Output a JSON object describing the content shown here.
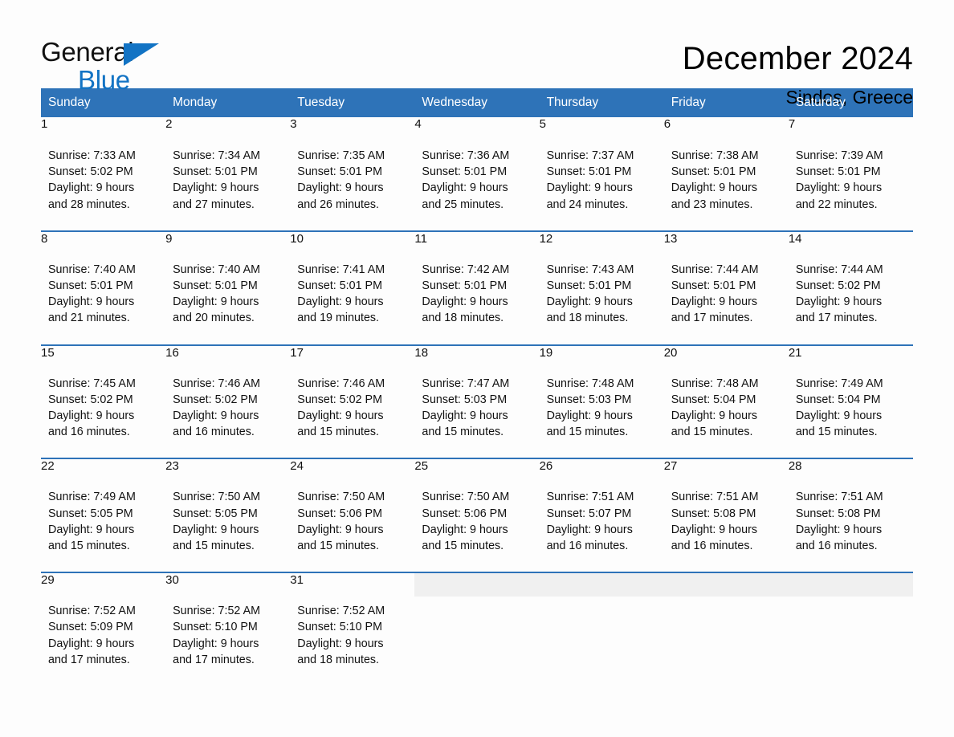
{
  "brand": {
    "name_part1": "General",
    "name_part2": "Blue",
    "triangle_color": "#1273c4"
  },
  "header": {
    "title": "December 2024",
    "subtitle": "Sindos, Greece"
  },
  "colors": {
    "header_blue": "#2e73b8",
    "daynum_band": "#f0f0f0",
    "page_background": "#fdfdfd",
    "text": "#111111"
  },
  "calendar": {
    "weekday_headers": [
      "Sunday",
      "Monday",
      "Tuesday",
      "Wednesday",
      "Thursday",
      "Friday",
      "Saturday"
    ],
    "weeks": [
      [
        {
          "day": "1",
          "sunrise": "Sunrise: 7:33 AM",
          "sunset": "Sunset: 5:02 PM",
          "daylight_line1": "Daylight: 9 hours",
          "daylight_line2": "and 28 minutes."
        },
        {
          "day": "2",
          "sunrise": "Sunrise: 7:34 AM",
          "sunset": "Sunset: 5:01 PM",
          "daylight_line1": "Daylight: 9 hours",
          "daylight_line2": "and 27 minutes."
        },
        {
          "day": "3",
          "sunrise": "Sunrise: 7:35 AM",
          "sunset": "Sunset: 5:01 PM",
          "daylight_line1": "Daylight: 9 hours",
          "daylight_line2": "and 26 minutes."
        },
        {
          "day": "4",
          "sunrise": "Sunrise: 7:36 AM",
          "sunset": "Sunset: 5:01 PM",
          "daylight_line1": "Daylight: 9 hours",
          "daylight_line2": "and 25 minutes."
        },
        {
          "day": "5",
          "sunrise": "Sunrise: 7:37 AM",
          "sunset": "Sunset: 5:01 PM",
          "daylight_line1": "Daylight: 9 hours",
          "daylight_line2": "and 24 minutes."
        },
        {
          "day": "6",
          "sunrise": "Sunrise: 7:38 AM",
          "sunset": "Sunset: 5:01 PM",
          "daylight_line1": "Daylight: 9 hours",
          "daylight_line2": "and 23 minutes."
        },
        {
          "day": "7",
          "sunrise": "Sunrise: 7:39 AM",
          "sunset": "Sunset: 5:01 PM",
          "daylight_line1": "Daylight: 9 hours",
          "daylight_line2": "and 22 minutes."
        }
      ],
      [
        {
          "day": "8",
          "sunrise": "Sunrise: 7:40 AM",
          "sunset": "Sunset: 5:01 PM",
          "daylight_line1": "Daylight: 9 hours",
          "daylight_line2": "and 21 minutes."
        },
        {
          "day": "9",
          "sunrise": "Sunrise: 7:40 AM",
          "sunset": "Sunset: 5:01 PM",
          "daylight_line1": "Daylight: 9 hours",
          "daylight_line2": "and 20 minutes."
        },
        {
          "day": "10",
          "sunrise": "Sunrise: 7:41 AM",
          "sunset": "Sunset: 5:01 PM",
          "daylight_line1": "Daylight: 9 hours",
          "daylight_line2": "and 19 minutes."
        },
        {
          "day": "11",
          "sunrise": "Sunrise: 7:42 AM",
          "sunset": "Sunset: 5:01 PM",
          "daylight_line1": "Daylight: 9 hours",
          "daylight_line2": "and 18 minutes."
        },
        {
          "day": "12",
          "sunrise": "Sunrise: 7:43 AM",
          "sunset": "Sunset: 5:01 PM",
          "daylight_line1": "Daylight: 9 hours",
          "daylight_line2": "and 18 minutes."
        },
        {
          "day": "13",
          "sunrise": "Sunrise: 7:44 AM",
          "sunset": "Sunset: 5:01 PM",
          "daylight_line1": "Daylight: 9 hours",
          "daylight_line2": "and 17 minutes."
        },
        {
          "day": "14",
          "sunrise": "Sunrise: 7:44 AM",
          "sunset": "Sunset: 5:02 PM",
          "daylight_line1": "Daylight: 9 hours",
          "daylight_line2": "and 17 minutes."
        }
      ],
      [
        {
          "day": "15",
          "sunrise": "Sunrise: 7:45 AM",
          "sunset": "Sunset: 5:02 PM",
          "daylight_line1": "Daylight: 9 hours",
          "daylight_line2": "and 16 minutes."
        },
        {
          "day": "16",
          "sunrise": "Sunrise: 7:46 AM",
          "sunset": "Sunset: 5:02 PM",
          "daylight_line1": "Daylight: 9 hours",
          "daylight_line2": "and 16 minutes."
        },
        {
          "day": "17",
          "sunrise": "Sunrise: 7:46 AM",
          "sunset": "Sunset: 5:02 PM",
          "daylight_line1": "Daylight: 9 hours",
          "daylight_line2": "and 15 minutes."
        },
        {
          "day": "18",
          "sunrise": "Sunrise: 7:47 AM",
          "sunset": "Sunset: 5:03 PM",
          "daylight_line1": "Daylight: 9 hours",
          "daylight_line2": "and 15 minutes."
        },
        {
          "day": "19",
          "sunrise": "Sunrise: 7:48 AM",
          "sunset": "Sunset: 5:03 PM",
          "daylight_line1": "Daylight: 9 hours",
          "daylight_line2": "and 15 minutes."
        },
        {
          "day": "20",
          "sunrise": "Sunrise: 7:48 AM",
          "sunset": "Sunset: 5:04 PM",
          "daylight_line1": "Daylight: 9 hours",
          "daylight_line2": "and 15 minutes."
        },
        {
          "day": "21",
          "sunrise": "Sunrise: 7:49 AM",
          "sunset": "Sunset: 5:04 PM",
          "daylight_line1": "Daylight: 9 hours",
          "daylight_line2": "and 15 minutes."
        }
      ],
      [
        {
          "day": "22",
          "sunrise": "Sunrise: 7:49 AM",
          "sunset": "Sunset: 5:05 PM",
          "daylight_line1": "Daylight: 9 hours",
          "daylight_line2": "and 15 minutes."
        },
        {
          "day": "23",
          "sunrise": "Sunrise: 7:50 AM",
          "sunset": "Sunset: 5:05 PM",
          "daylight_line1": "Daylight: 9 hours",
          "daylight_line2": "and 15 minutes."
        },
        {
          "day": "24",
          "sunrise": "Sunrise: 7:50 AM",
          "sunset": "Sunset: 5:06 PM",
          "daylight_line1": "Daylight: 9 hours",
          "daylight_line2": "and 15 minutes."
        },
        {
          "day": "25",
          "sunrise": "Sunrise: 7:50 AM",
          "sunset": "Sunset: 5:06 PM",
          "daylight_line1": "Daylight: 9 hours",
          "daylight_line2": "and 15 minutes."
        },
        {
          "day": "26",
          "sunrise": "Sunrise: 7:51 AM",
          "sunset": "Sunset: 5:07 PM",
          "daylight_line1": "Daylight: 9 hours",
          "daylight_line2": "and 16 minutes."
        },
        {
          "day": "27",
          "sunrise": "Sunrise: 7:51 AM",
          "sunset": "Sunset: 5:08 PM",
          "daylight_line1": "Daylight: 9 hours",
          "daylight_line2": "and 16 minutes."
        },
        {
          "day": "28",
          "sunrise": "Sunrise: 7:51 AM",
          "sunset": "Sunset: 5:08 PM",
          "daylight_line1": "Daylight: 9 hours",
          "daylight_line2": "and 16 minutes."
        }
      ],
      [
        {
          "day": "29",
          "sunrise": "Sunrise: 7:52 AM",
          "sunset": "Sunset: 5:09 PM",
          "daylight_line1": "Daylight: 9 hours",
          "daylight_line2": "and 17 minutes."
        },
        {
          "day": "30",
          "sunrise": "Sunrise: 7:52 AM",
          "sunset": "Sunset: 5:10 PM",
          "daylight_line1": "Daylight: 9 hours",
          "daylight_line2": "and 17 minutes."
        },
        {
          "day": "31",
          "sunrise": "Sunrise: 7:52 AM",
          "sunset": "Sunset: 5:10 PM",
          "daylight_line1": "Daylight: 9 hours",
          "daylight_line2": "and 18 minutes."
        },
        {
          "day": "",
          "sunrise": "",
          "sunset": "",
          "daylight_line1": "",
          "daylight_line2": ""
        },
        {
          "day": "",
          "sunrise": "",
          "sunset": "",
          "daylight_line1": "",
          "daylight_line2": ""
        },
        {
          "day": "",
          "sunrise": "",
          "sunset": "",
          "daylight_line1": "",
          "daylight_line2": ""
        },
        {
          "day": "",
          "sunrise": "",
          "sunset": "",
          "daylight_line1": "",
          "daylight_line2": ""
        }
      ]
    ]
  }
}
